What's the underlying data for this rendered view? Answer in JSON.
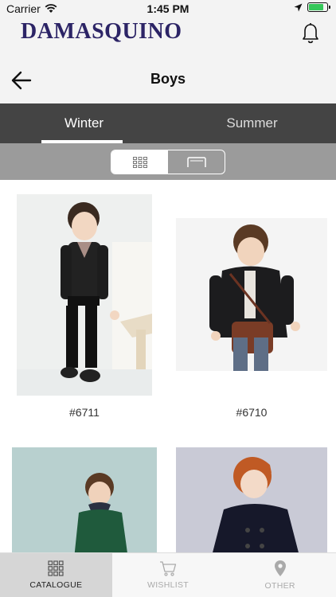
{
  "status": {
    "carrier": "Carrier",
    "time": "1:45 PM",
    "battery_level": 0.8
  },
  "brand": {
    "logo_text": "DAMASQUINO"
  },
  "header": {
    "title": "Boys"
  },
  "season_tabs": [
    {
      "label": "Winter",
      "active": true
    },
    {
      "label": "Summer",
      "active": false
    }
  ],
  "view_toggle": {
    "selected": "grid",
    "options": [
      "grid-icon",
      "single-view-icon"
    ]
  },
  "products": [
    {
      "code": "#6711"
    },
    {
      "code": "#6710"
    },
    {
      "code": ""
    },
    {
      "code": ""
    }
  ],
  "tabbar": [
    {
      "label": "CATALOGUE",
      "icon": "grid-icon",
      "active": true
    },
    {
      "label": "WISHLIST",
      "icon": "cart-icon",
      "active": false
    },
    {
      "label": "OTHER",
      "icon": "location-pin-icon",
      "active": false
    }
  ],
  "colors": {
    "brand": "#2c2466",
    "tab_bar_dark": "#444444",
    "toggle_bar": "#9b9b9b",
    "battery": "#35c759"
  }
}
